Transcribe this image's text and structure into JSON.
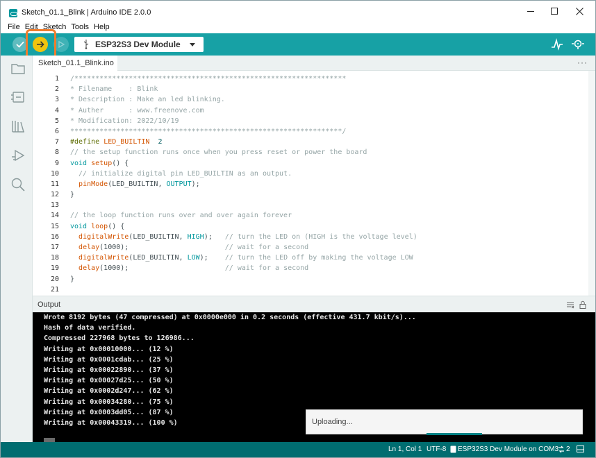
{
  "window": {
    "title": "Sketch_01.1_Blink | Arduino IDE 2.0.0"
  },
  "menu": {
    "items": [
      "File",
      "Edit",
      "Sketch",
      "Tools",
      "Help"
    ]
  },
  "toolbar": {
    "board": "ESP32S3 Dev Module",
    "icons": [
      "verify-icon",
      "upload-icon",
      "debug-icon",
      "usb-icon",
      "serial-plotter-icon",
      "serial-monitor-icon"
    ]
  },
  "sidebar": {
    "icons": [
      "folder-icon",
      "board-manager-icon",
      "library-icon",
      "debug-icon",
      "search-icon"
    ]
  },
  "tab": {
    "label": "Sketch_01.1_Blink.ino",
    "more": "···"
  },
  "editor": {
    "line_numbers": [
      "1",
      "2",
      "3",
      "4",
      "5",
      "6",
      "7",
      "8",
      "9",
      "10",
      "11",
      "12",
      "13",
      "14",
      "15",
      "16",
      "17",
      "18",
      "19",
      "20",
      "21"
    ],
    "code": [
      "/*****************************************************************",
      "* Filename    : Blink",
      "* Description : Make an led blinking.",
      "* Auther      : www.freenove.com",
      "* Modification: 2022/10/19",
      "*****************************************************************/",
      "#define LED_BUILTIN  2",
      "// the setup function runs once when you press reset or power the board",
      "void setup() {",
      "  // initialize digital pin LED_BUILTIN as an output.",
      "  pinMode(LED_BUILTIN, OUTPUT);",
      "}",
      "",
      "// the loop function runs over and over again forever",
      "void loop() {",
      "  digitalWrite(LED_BUILTIN, HIGH);   // turn the LED on (HIGH is the voltage level)",
      "  delay(1000);                       // wait for a second",
      "  digitalWrite(LED_BUILTIN, LOW);    // turn the LED off by making the voltage LOW",
      "  delay(1000);                       // wait for a second",
      "}",
      ""
    ]
  },
  "output": {
    "title": "Output",
    "lines": [
      "Wrote 8192 bytes (47 compressed) at 0x0000e000 in 0.2 seconds (effective 431.7 kbit/s)...",
      "Hash of data verified.",
      "Compressed 227968 bytes to 126986...",
      "Writing at 0x00010000... (12 %)",
      "Writing at 0x0001cdab... (25 %)",
      "Writing at 0x00022890... (37 %)",
      "Writing at 0x00027d25... (50 %)",
      "Writing at 0x0002d247... (62 %)",
      "Writing at 0x00034280... (75 %)",
      "Writing at 0x0003dd05... (87 %)",
      "Writing at 0x00043319... (100 %)"
    ]
  },
  "notification": {
    "text": "Uploading..."
  },
  "status": {
    "position": "Ln 1, Col 1",
    "encoding": "UTF-8",
    "board_port": "ESP32S3 Dev Module on COM3",
    "notifications": "2"
  }
}
